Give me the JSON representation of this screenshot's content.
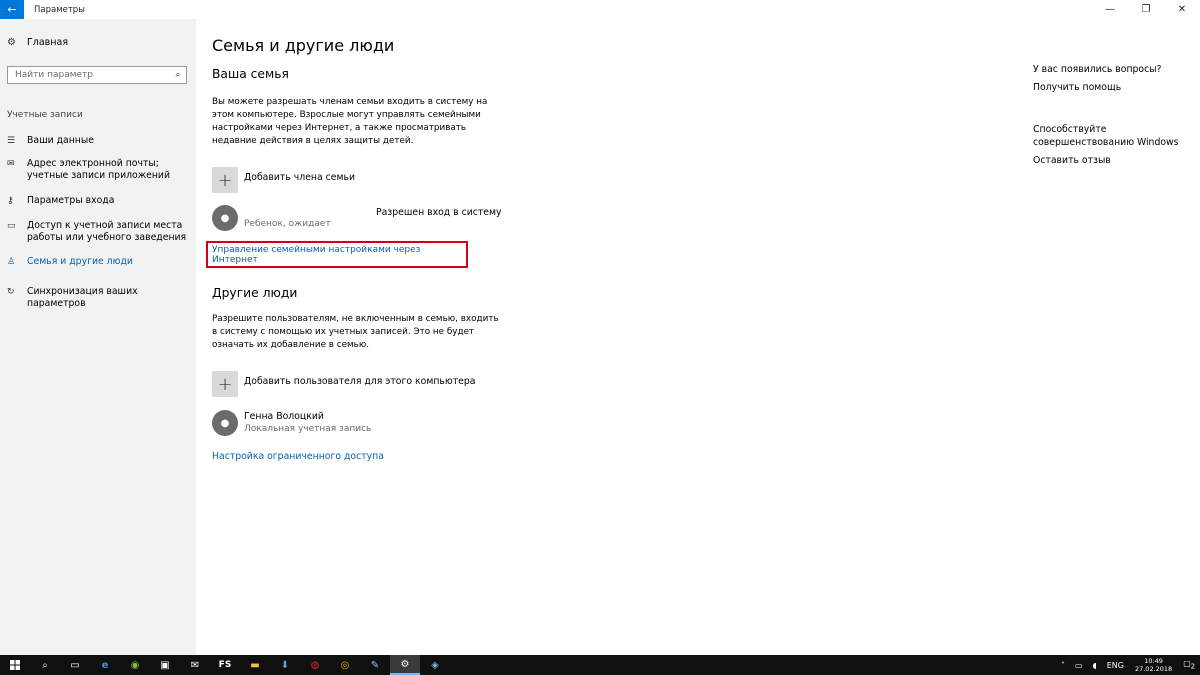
{
  "window": {
    "title": "Параметры",
    "back_icon": "←",
    "minimize_icon": "—",
    "restore_icon": "❐",
    "close_icon": "✕"
  },
  "sidebar": {
    "home_label": "Главная",
    "home_icon": "⚙",
    "search_placeholder": "Найти параметр",
    "search_icon": "⌕",
    "section_label": "Учетные записи",
    "items": [
      {
        "label": "Ваши данные",
        "icon": "☰"
      },
      {
        "label": "Адрес электронной почты; учетные записи приложений",
        "icon": "✉"
      },
      {
        "label": "Параметры входа",
        "icon": "⚷"
      },
      {
        "label": "Доступ к учетной записи места работы или учебного заведения",
        "icon": "▭"
      },
      {
        "label": "Семья и другие люди",
        "icon": "♙",
        "active": true
      },
      {
        "label": "Синхронизация ваших параметров",
        "icon": "↻"
      }
    ]
  },
  "main": {
    "page_title": "Семья и другие люди",
    "family": {
      "heading": "Ваша семья",
      "description": "Вы можете разрешать членам семьи входить в систему на этом компьютере. Взрослые могут управлять семейными настройками через Интернет, а также просматривать недавние действия в целях защиты детей.",
      "add_label": "Добавить члена семьи",
      "member_role": "Ребенок, ожидает",
      "member_status": "Разрешен вход в систему",
      "manage_link": "Управление семейными настройками через Интернет"
    },
    "others": {
      "heading": "Другие люди",
      "description": "Разрешите пользователям, не включенным в семью, входить в систему с помощью их учетных записей. Это не будет означать их добавление в семью.",
      "add_label": "Добавить пользователя для этого компьютера",
      "user_name": "Генна Волоцкий",
      "user_type": "Локальная учетная запись",
      "restricted_link": "Настройка ограниченного доступа"
    }
  },
  "aside": {
    "question": "У вас появились вопросы?",
    "help_link": "Получить помощь",
    "improve_text": "Способствуйте совершенствованию Windows",
    "feedback_link": "Оставить отзыв"
  },
  "taskbar": {
    "lang": "ENG",
    "time": "10:49",
    "date": "27.02.2018",
    "notifications": "2"
  }
}
